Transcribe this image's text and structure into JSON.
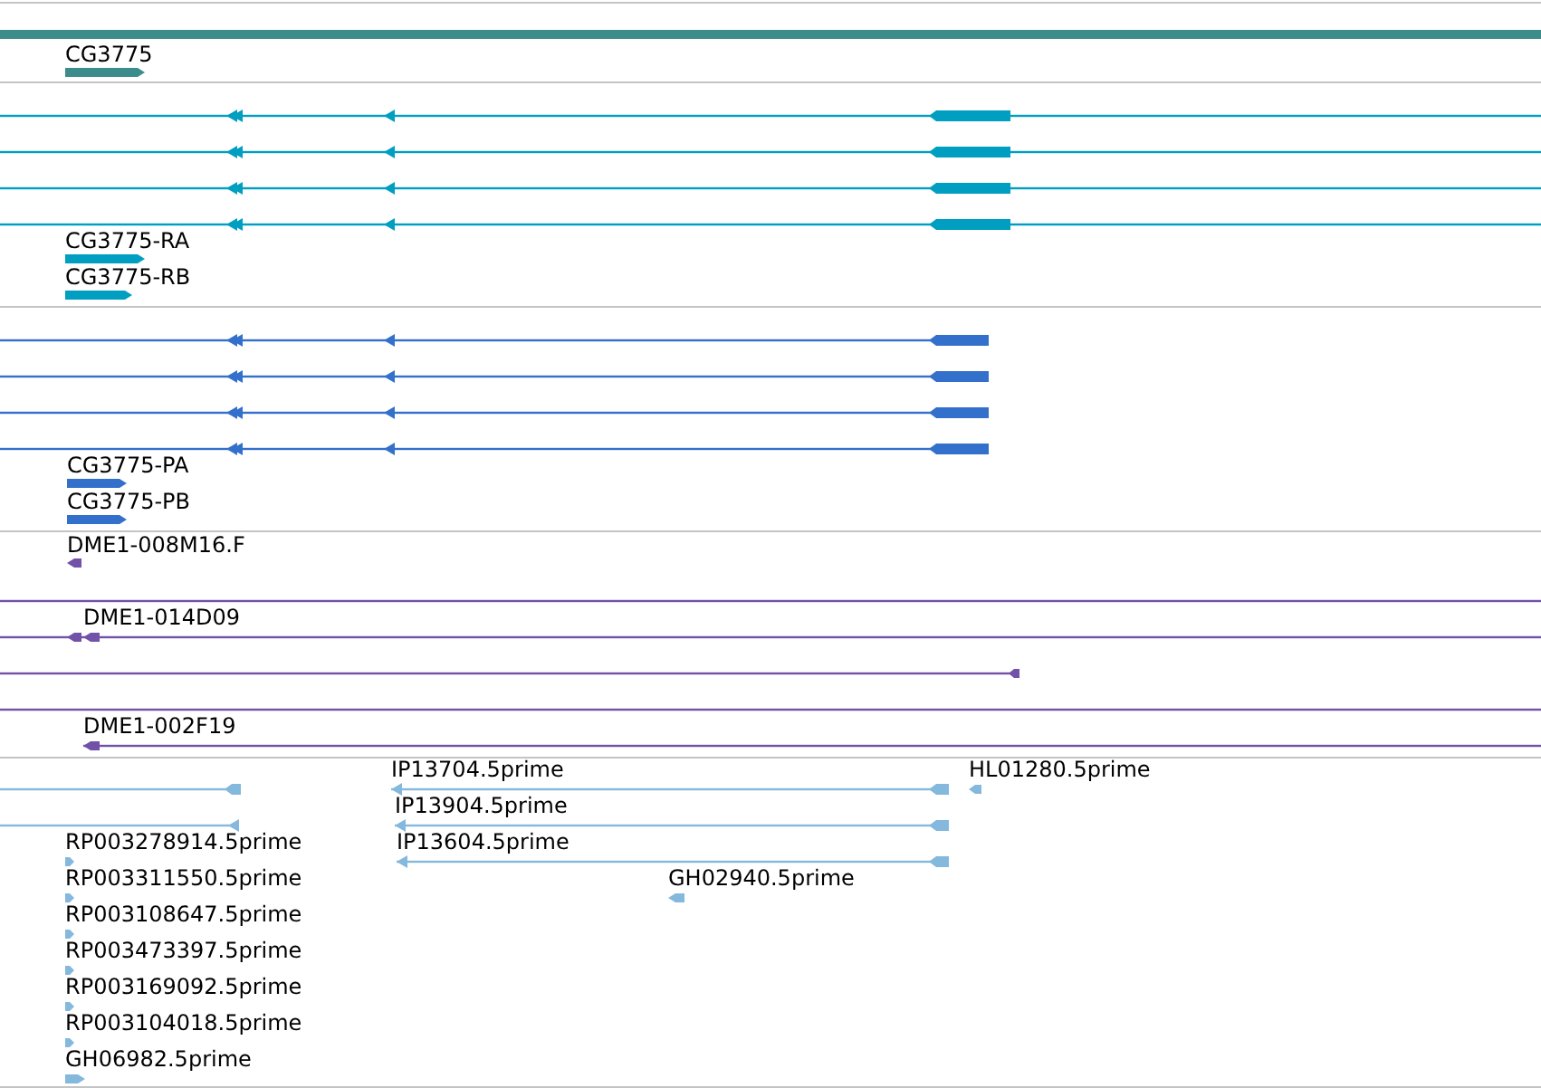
{
  "tracks": [
    {
      "color": "#3d8c8c",
      "features": [
        {
          "kind": "span"
        },
        {
          "kind": "glyph",
          "label": "CG3775"
        }
      ]
    },
    {
      "color": "#009ec0",
      "features": [
        {
          "kind": "model"
        },
        {
          "kind": "model"
        },
        {
          "kind": "model"
        },
        {
          "kind": "model"
        },
        {
          "kind": "glyph",
          "label": "CG3775-RA"
        },
        {
          "kind": "glyph",
          "label": "CG3775-RB"
        }
      ]
    },
    {
      "color": "#3370cc",
      "features": [
        {
          "kind": "model"
        },
        {
          "kind": "model"
        },
        {
          "kind": "model"
        },
        {
          "kind": "model"
        },
        {
          "kind": "glyph",
          "label": "CG3775-PA"
        },
        {
          "kind": "glyph",
          "label": "CG3775-PB"
        }
      ]
    },
    {
      "color": "#7152a8",
      "features": [
        {
          "kind": "glyph",
          "label": "DME1-008M16.F"
        },
        {
          "kind": "model"
        },
        {
          "kind": "model",
          "label": "DME1-014D09"
        },
        {
          "kind": "model"
        },
        {
          "kind": "model"
        },
        {
          "kind": "model",
          "label": "DME1-002F19"
        }
      ]
    },
    {
      "color": "#84b8dc",
      "features": [
        {
          "kind": "model"
        },
        {
          "kind": "model"
        },
        {
          "kind": "model",
          "label": "IP13704.5prime"
        },
        {
          "kind": "model",
          "label": "IP13904.5prime"
        },
        {
          "kind": "model",
          "label": "IP13604.5prime"
        },
        {
          "kind": "glyph",
          "label": "HL01280.5prime"
        },
        {
          "kind": "glyph",
          "label": "GH02940.5prime"
        },
        {
          "kind": "glyph",
          "label": "RP003278914.5prime"
        },
        {
          "kind": "glyph",
          "label": "RP003311550.5prime"
        },
        {
          "kind": "glyph",
          "label": "RP003108647.5prime"
        },
        {
          "kind": "glyph",
          "label": "RP003473397.5prime"
        },
        {
          "kind": "glyph",
          "label": "RP003169092.5prime"
        },
        {
          "kind": "glyph",
          "label": "RP003104018.5prime"
        },
        {
          "kind": "glyph",
          "label": "GH06982.5prime"
        }
      ]
    }
  ]
}
